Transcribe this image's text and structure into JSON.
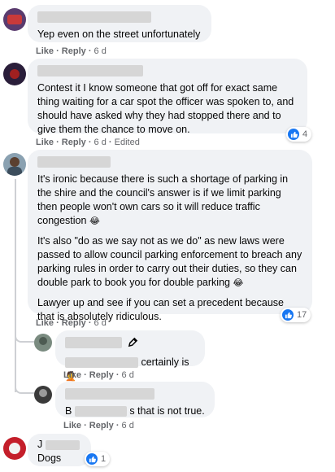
{
  "comments": [
    {
      "text": "Yep even on the street unfortunately",
      "actions": {
        "like": "Like",
        "reply": "Reply",
        "time": "6 d"
      }
    },
    {
      "text": "Contest it I know someone that got off for exact same thing waiting for a car spot the officer was spoken to, and should have asked why they had stopped there and to give them the chance to move on.",
      "actions": {
        "like": "Like",
        "reply": "Reply",
        "time": "6 d",
        "edited": "Edited"
      },
      "reaction_count": "4"
    },
    {
      "paragraphs": [
        "It's ironic because there is such a shortage of parking in the shire and the council's answer is if we limit parking then people won't own cars so it will reduce traffic congestion",
        "It's also \"do as we say not as we do\" as new laws were passed to allow council parking enforcement to breach any parking rules in order to carry out their duties, so they can double park to book you for double parking",
        "Lawyer up and see if you can set a precedent because that is absolutely ridiculous."
      ],
      "emoji_1": "😂",
      "emoji_2": "😂",
      "actions": {
        "like": "Like",
        "reply": "Reply",
        "time": "6 d"
      },
      "reaction_count": "17"
    },
    {
      "text": "certainly is",
      "emoji": "🤦",
      "actions": {
        "like": "Like",
        "reply": "Reply",
        "time": "6 d"
      }
    },
    {
      "text_prefix": "B",
      "text": "s that is not true.",
      "actions": {
        "like": "Like",
        "reply": "Reply",
        "time": "6 d"
      }
    },
    {
      "text_prefix": "J",
      "text": "Dogs",
      "reaction_count": "1"
    }
  ],
  "colors": {
    "like_blue": "#1877f2",
    "bubble": "#f0f2f5",
    "meta": "#65676b"
  },
  "icons": [
    "like-icon",
    "pen-icon"
  ]
}
